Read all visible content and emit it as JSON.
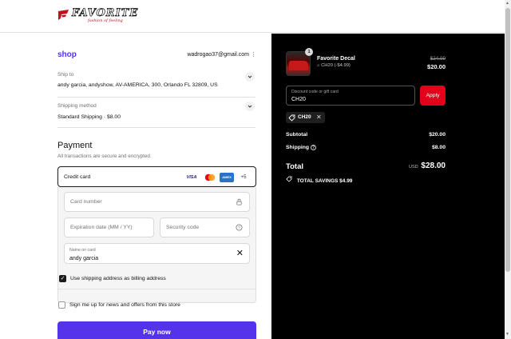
{
  "header": {
    "logo_text": "FAVORITE",
    "logo_tagline": "fashion of feeling"
  },
  "contact": {
    "shop_label": "shop",
    "email": "wadrogao37@gmail.com",
    "menu_icon": "kebab-icon"
  },
  "ship_to": {
    "label": "Ship to",
    "value": "andy garcia, andyshow, AV-AMERICA, 300, Orlando FL 32809, US"
  },
  "shipping_method": {
    "label": "Shipping method",
    "value": "Standard Shipping · $8.00"
  },
  "payment": {
    "title": "Payment",
    "subtitle": "All transactions are secure and encrypted.",
    "method_label": "Credit card",
    "card_brands": [
      "VISA",
      "mastercard",
      "AMEX",
      "+5"
    ],
    "card_number_placeholder": "Card number",
    "expiration_placeholder": "Expiration date (MM / YY)",
    "security_code_placeholder": "Security code",
    "name_on_card_label": "Name on card",
    "name_on_card_value": "andy garcia"
  },
  "billing": {
    "same_address_label": "Use shipping address as billing address",
    "same_address_checked": true
  },
  "newsletter": {
    "label": "Sign me up for news and offers from this store",
    "checked": false
  },
  "pay_button": "Pay now",
  "summary": {
    "quantity": "1",
    "product_name": "Favorite Decal",
    "product_discount": "CH20 (-$4.99)",
    "price_original": "$24.99",
    "price_final": "$20.00",
    "discount_placeholder": "Discount code or gift card",
    "discount_value": "CH20",
    "apply_label": "Apply",
    "applied_code": "CH20",
    "subtotal_label": "Subtotal",
    "subtotal_value": "$20.00",
    "shipping_label": "Shipping",
    "shipping_value": "$8.00",
    "total_label": "Total",
    "currency": "USD",
    "total_value": "$28.00",
    "savings_label": "TOTAL SAVINGS",
    "savings_value": "$4.99"
  },
  "colors": {
    "brand_purple": "#5433eb",
    "apply_red": "#e3001b",
    "summary_bg": "#000000"
  }
}
